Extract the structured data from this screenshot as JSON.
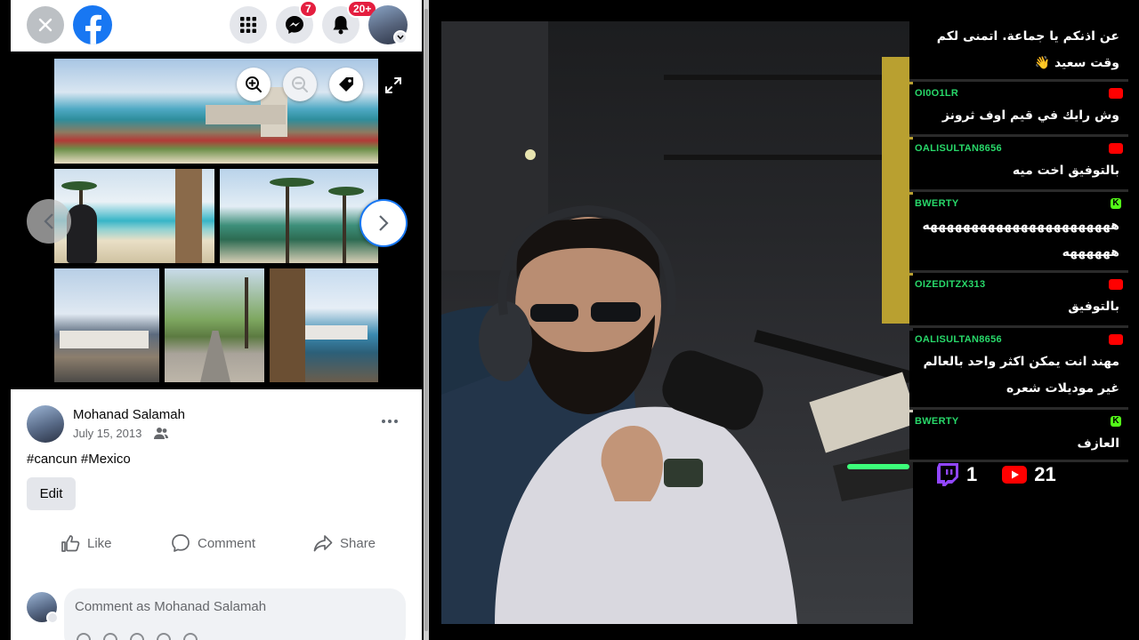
{
  "facebook": {
    "notifications": {
      "messenger_badge": "7",
      "notification_badge": "20+"
    },
    "post": {
      "author": "Mohanad Salamah",
      "date": "July 15, 2013",
      "caption": "#cancun #Mexico",
      "edit_label": "Edit",
      "actions": {
        "like": "Like",
        "comment": "Comment",
        "share": "Share"
      },
      "comment_placeholder": "Comment as Mohanad Salamah"
    },
    "colors": {
      "brand": "#1877f2",
      "badge": "#e41e3f",
      "muted_text": "#65676b"
    }
  },
  "chat": {
    "messages": [
      {
        "user": "",
        "platform": "",
        "text": "عن اذنكم يا جماعة. اتمنى لكم وقت سعيد 👋"
      },
      {
        "user": "OI0O1LR",
        "platform": "youtube",
        "text": "وش رايك في قيم اوف ثرونز"
      },
      {
        "user": "OALISULTAN8656",
        "platform": "youtube",
        "text": "بالتوفيق اخت ميه"
      },
      {
        "user": "BWERTY",
        "platform": "kick",
        "text": "هههههههههههههههههههههههه ههههههه"
      },
      {
        "user": "OIZEDITZX313",
        "platform": "youtube",
        "text": "بالتوفيق"
      },
      {
        "user": "OALISULTAN8656",
        "platform": "youtube",
        "text": "مهند انت يمكن اكثر واحد بالعالم غير موديلات شعره"
      },
      {
        "user": "BWERTY",
        "platform": "kick",
        "text": "العازف"
      }
    ],
    "viewers": {
      "twitch": "1",
      "youtube": "21"
    },
    "colors": {
      "username": "#28d96a",
      "youtube": "#ff0000",
      "kick": "#53fc18",
      "twitch": "#9146ff"
    }
  }
}
